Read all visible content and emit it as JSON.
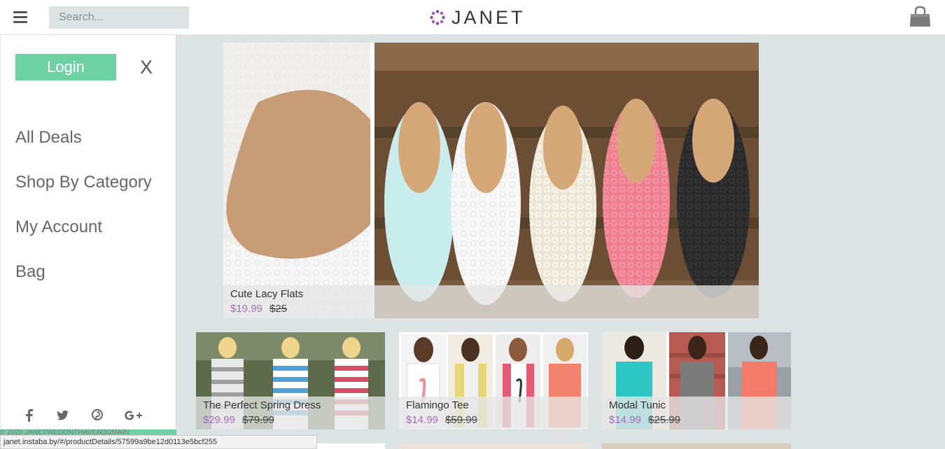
{
  "header": {
    "search_placeholder": "Search...",
    "logo_text": "JANET"
  },
  "drawer": {
    "login_label": "Login",
    "close_label": "X",
    "nav": [
      "All Deals",
      "Shop By Category",
      "My Account",
      "Bag"
    ],
    "social": [
      "f",
      "𝕥",
      "p",
      "G+"
    ],
    "copyright": "© 2020 JANETWEDONTHAVEADOMAIN"
  },
  "status_url": "janet.instaba.by/#/productDetails/57599a9be12d0113e5bcf255",
  "hero": {
    "name": "Cute Lacy Flats",
    "price": "$19.99",
    "old_price": "$25"
  },
  "products": [
    {
      "name": "The Perfect Spring Dress",
      "price": "$29.99",
      "old_price": "$79.99"
    },
    {
      "name": "Flamingo Tee",
      "price": "$14.99",
      "old_price": "$59.99"
    },
    {
      "name": "Modal Tunic",
      "price": "$14.99",
      "old_price": "$25.99"
    }
  ],
  "colors": {
    "accent": "#6ed1a3",
    "price": "#a36fc0",
    "background": "#dde2e2",
    "logo_mark": "#8e44ad"
  },
  "icons": [
    "hamburger-icon",
    "shopping-bag-icon",
    "facebook-icon",
    "twitter-icon",
    "pinterest-icon",
    "google-plus-icon"
  ]
}
